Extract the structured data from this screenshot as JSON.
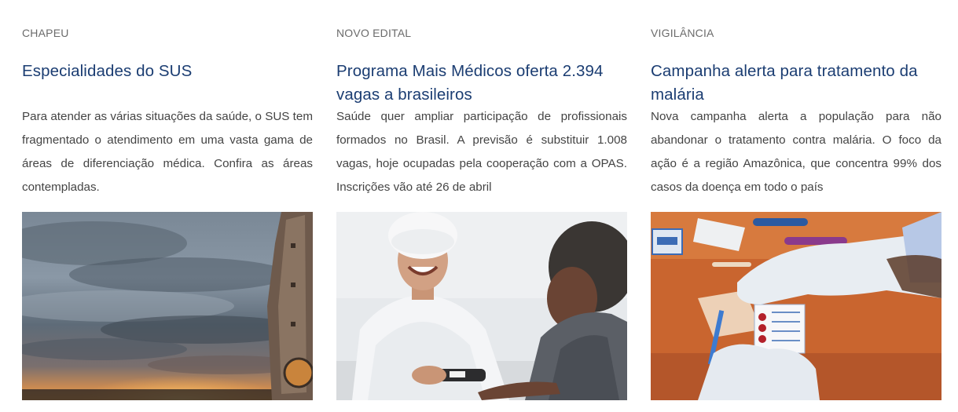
{
  "cards": [
    {
      "kicker": "CHAPEU",
      "title": "Especialidades do SUS",
      "description": "Para atender as várias situações da saúde, o SUS tem fragmentado o atendimento em uma vasta gama de áreas de diferenciação médica. Confira as áreas contempladas.",
      "image": "sunset-sky-photo"
    },
    {
      "kicker": "NOVO EDITAL",
      "title": "Programa Mais Médicos oferta 2.394 vagas a brasileiros",
      "description": "Saúde quer ampliar participação de profissionais formados no Brasil. A previsão é substituir 1.008 vagas, hoje ocupadas pela cooperação com a OPAS. Inscrições vão até 26 de abril",
      "image": "doctor-patient-photo"
    },
    {
      "kicker": "VIGILÂNCIA",
      "title": "Campanha alerta para tratamento da malária",
      "description": "Nova campanha alerta a população para não abandonar o tratamento contra malária. O foco da ação é a região Amazônica, que concentra 99% dos casos da doença em todo o país",
      "image": "malaria-test-photo"
    }
  ],
  "colors": {
    "title": "#1b3d72",
    "kicker": "#6b6b6b",
    "text": "#444444"
  }
}
